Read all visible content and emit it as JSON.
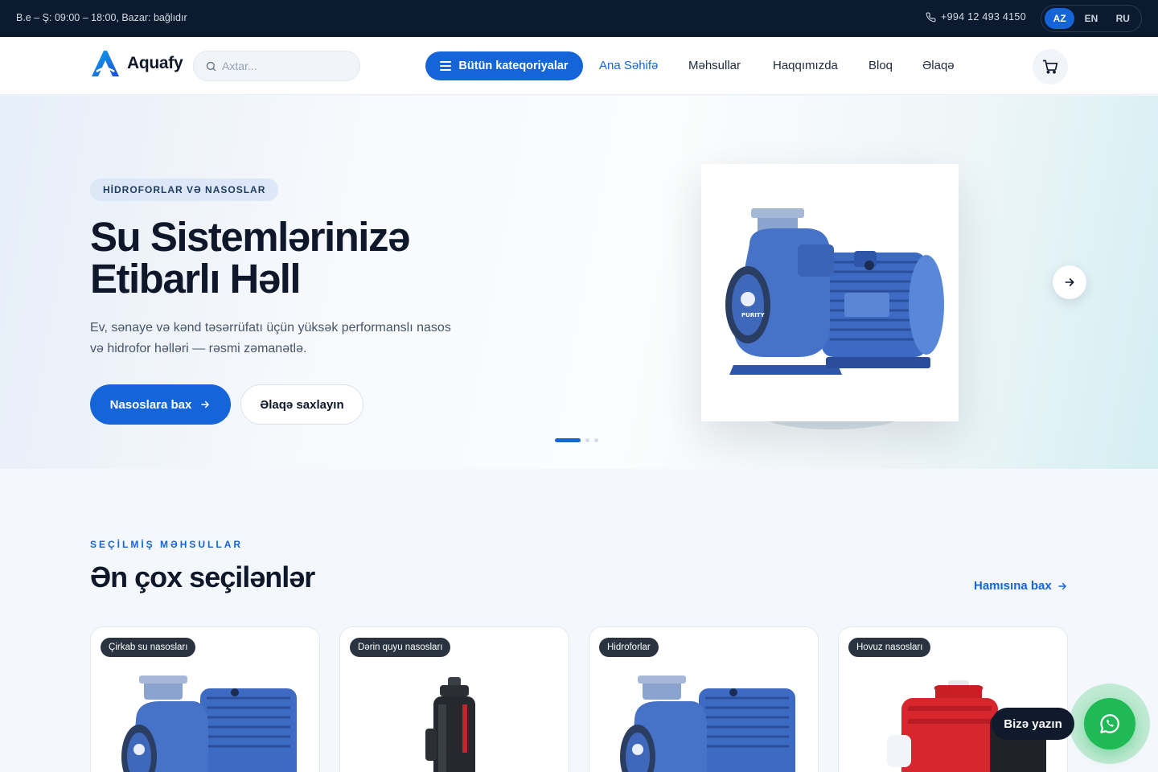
{
  "topbar": {
    "hours": "B.e – Ş: 09:00 – 18:00, Bazar: bağlıdır",
    "phone": "+994 12 493 4150",
    "languages": [
      "AZ",
      "EN",
      "RU"
    ],
    "active_language": "AZ"
  },
  "header": {
    "brand": "Aquafy",
    "search_placeholder": "Axtar...",
    "categories_button": "Bütün kateqoriyalar",
    "nav": [
      "Ana Səhifə",
      "Məhsullar",
      "Haqqımızda",
      "Bloq",
      "Əlaqə"
    ],
    "active_nav": "Ana Səhifə"
  },
  "hero": {
    "badge": "HİDROFORLAR VƏ NASOSLAR",
    "title_line1": "Su Sistemlərinizə",
    "title_line2": "Etibarlı Həll",
    "subtitle": "Ev, sənaye və kənd təsərrüfatı üçün yüksək performanslı nasos və hidrofor həlləri — rəsmi zəmanətlə.",
    "primary_button": "Nasoslara bax",
    "secondary_button": "Əlaqə saxlayın",
    "slide_count": 3,
    "active_slide": 1,
    "product_brand": "PURITY"
  },
  "featured": {
    "eyebrow": "SEÇİLMİŞ MƏHSULLAR",
    "title": "Ən çox seçilənlər",
    "see_all": "Hamısına bax",
    "products": [
      {
        "tag": "Çirkab su nasosları",
        "image": "blue-centrifugal-pump"
      },
      {
        "tag": "Dərin quyu nasosları",
        "image": "black-submersible-pump"
      },
      {
        "tag": "Hidroforlar",
        "image": "blue-centrifugal-pump"
      },
      {
        "tag": "Hovuz nasosları",
        "image": "red-pool-pump"
      }
    ]
  },
  "chat": {
    "label": "Bizə yazın",
    "icon": "whatsapp-icon"
  },
  "colors": {
    "accent": "#1565d8",
    "topbar": "#0b1a2e",
    "whatsapp": "#1fb955"
  }
}
